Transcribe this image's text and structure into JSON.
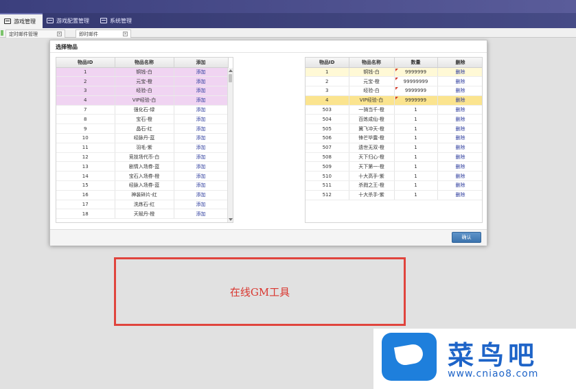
{
  "menu": [
    {
      "label": "游戏管理",
      "icon": "window-icon",
      "active": true
    },
    {
      "label": "游戏配置管理",
      "icon": "window-icon",
      "active": false
    },
    {
      "label": "系统管理",
      "icon": "window-icon",
      "active": false
    }
  ],
  "tabs": [
    {
      "label": "定时邮件管理",
      "close": "×"
    },
    {
      "label": "即时邮件",
      "close": "×"
    }
  ],
  "dialog": {
    "title": "选择物品",
    "confirm_label": "确认"
  },
  "left_table": {
    "headers": [
      "物品ID",
      "物品名称",
      "添加"
    ],
    "rows": [
      {
        "id": "1",
        "name": "铜钱-白",
        "action": "添加",
        "selected": true
      },
      {
        "id": "2",
        "name": "元宝-橙",
        "action": "添加",
        "selected": true
      },
      {
        "id": "3",
        "name": "经验-白",
        "action": "添加",
        "selected": true
      },
      {
        "id": "4",
        "name": "VIP经验-白",
        "action": "添加",
        "selected": true
      },
      {
        "id": "7",
        "name": "强化石-绿",
        "action": "添加",
        "selected": false
      },
      {
        "id": "8",
        "name": "宝石-橙",
        "action": "添加",
        "selected": false
      },
      {
        "id": "9",
        "name": "晶石-红",
        "action": "添加",
        "selected": false
      },
      {
        "id": "10",
        "name": "经脉丹-蓝",
        "action": "添加",
        "selected": false
      },
      {
        "id": "11",
        "name": "羽毛-紫",
        "action": "添加",
        "selected": false
      },
      {
        "id": "12",
        "name": "竞技场代币-白",
        "action": "添加",
        "selected": false
      },
      {
        "id": "13",
        "name": "剧情入场券-蓝",
        "action": "添加",
        "selected": false
      },
      {
        "id": "14",
        "name": "宝石入场券-橙",
        "action": "添加",
        "selected": false
      },
      {
        "id": "15",
        "name": "经脉入场券-蓝",
        "action": "添加",
        "selected": false
      },
      {
        "id": "16",
        "name": "神装碎片-红",
        "action": "添加",
        "selected": false
      },
      {
        "id": "17",
        "name": "洗炼石-红",
        "action": "添加",
        "selected": false
      },
      {
        "id": "18",
        "name": "天赋丹-橙",
        "action": "添加",
        "selected": false
      }
    ]
  },
  "right_table": {
    "headers": [
      "物品ID",
      "物品名称",
      "数量",
      "删除"
    ],
    "rows": [
      {
        "id": "1",
        "name": "铜钱-白",
        "qty": "9999999",
        "action": "删除",
        "style": "yellow",
        "marked": true
      },
      {
        "id": "2",
        "name": "元宝-橙",
        "qty": "99999999",
        "action": "删除",
        "style": "white",
        "marked": true
      },
      {
        "id": "3",
        "name": "经验-白",
        "qty": "9999999",
        "action": "删除",
        "style": "white",
        "marked": true
      },
      {
        "id": "4",
        "name": "VIP经验-白",
        "qty": "9999999",
        "action": "删除",
        "style": "yellow-dark",
        "marked": true
      },
      {
        "id": "503",
        "name": "一骑当千-橙",
        "qty": "1",
        "action": "删除",
        "style": "white",
        "marked": false
      },
      {
        "id": "504",
        "name": "百炼成仙-橙",
        "qty": "1",
        "action": "删除",
        "style": "white",
        "marked": false
      },
      {
        "id": "505",
        "name": "冀飞冲天-橙",
        "qty": "1",
        "action": "删除",
        "style": "white",
        "marked": false
      },
      {
        "id": "506",
        "name": "锋芒毕露-橙",
        "qty": "1",
        "action": "删除",
        "style": "white",
        "marked": false
      },
      {
        "id": "507",
        "name": "遗世无双-橙",
        "qty": "1",
        "action": "删除",
        "style": "white",
        "marked": false
      },
      {
        "id": "508",
        "name": "天下归心-橙",
        "qty": "1",
        "action": "删除",
        "style": "white",
        "marked": false
      },
      {
        "id": "509",
        "name": "天下第一-橙",
        "qty": "1",
        "action": "删除",
        "style": "white",
        "marked": false
      },
      {
        "id": "510",
        "name": "十大高手-紫",
        "qty": "1",
        "action": "删除",
        "style": "white",
        "marked": false
      },
      {
        "id": "511",
        "name": "杀戮之王-橙",
        "qty": "1",
        "action": "删除",
        "style": "white",
        "marked": false
      },
      {
        "id": "512",
        "name": "十大杀手-紫",
        "qty": "1",
        "action": "删除",
        "style": "white",
        "marked": false
      }
    ]
  },
  "annotation": {
    "text": "在线GM工具",
    "color": "#e0443d"
  },
  "watermark": {
    "title": "菜鸟吧",
    "url": "www.cniao8.com"
  },
  "colors": {
    "selected_row": "#f0d4f2",
    "yellow_row": "#fff9d6",
    "link": "#2b3a9c",
    "menubar": "#3b3f7d"
  }
}
